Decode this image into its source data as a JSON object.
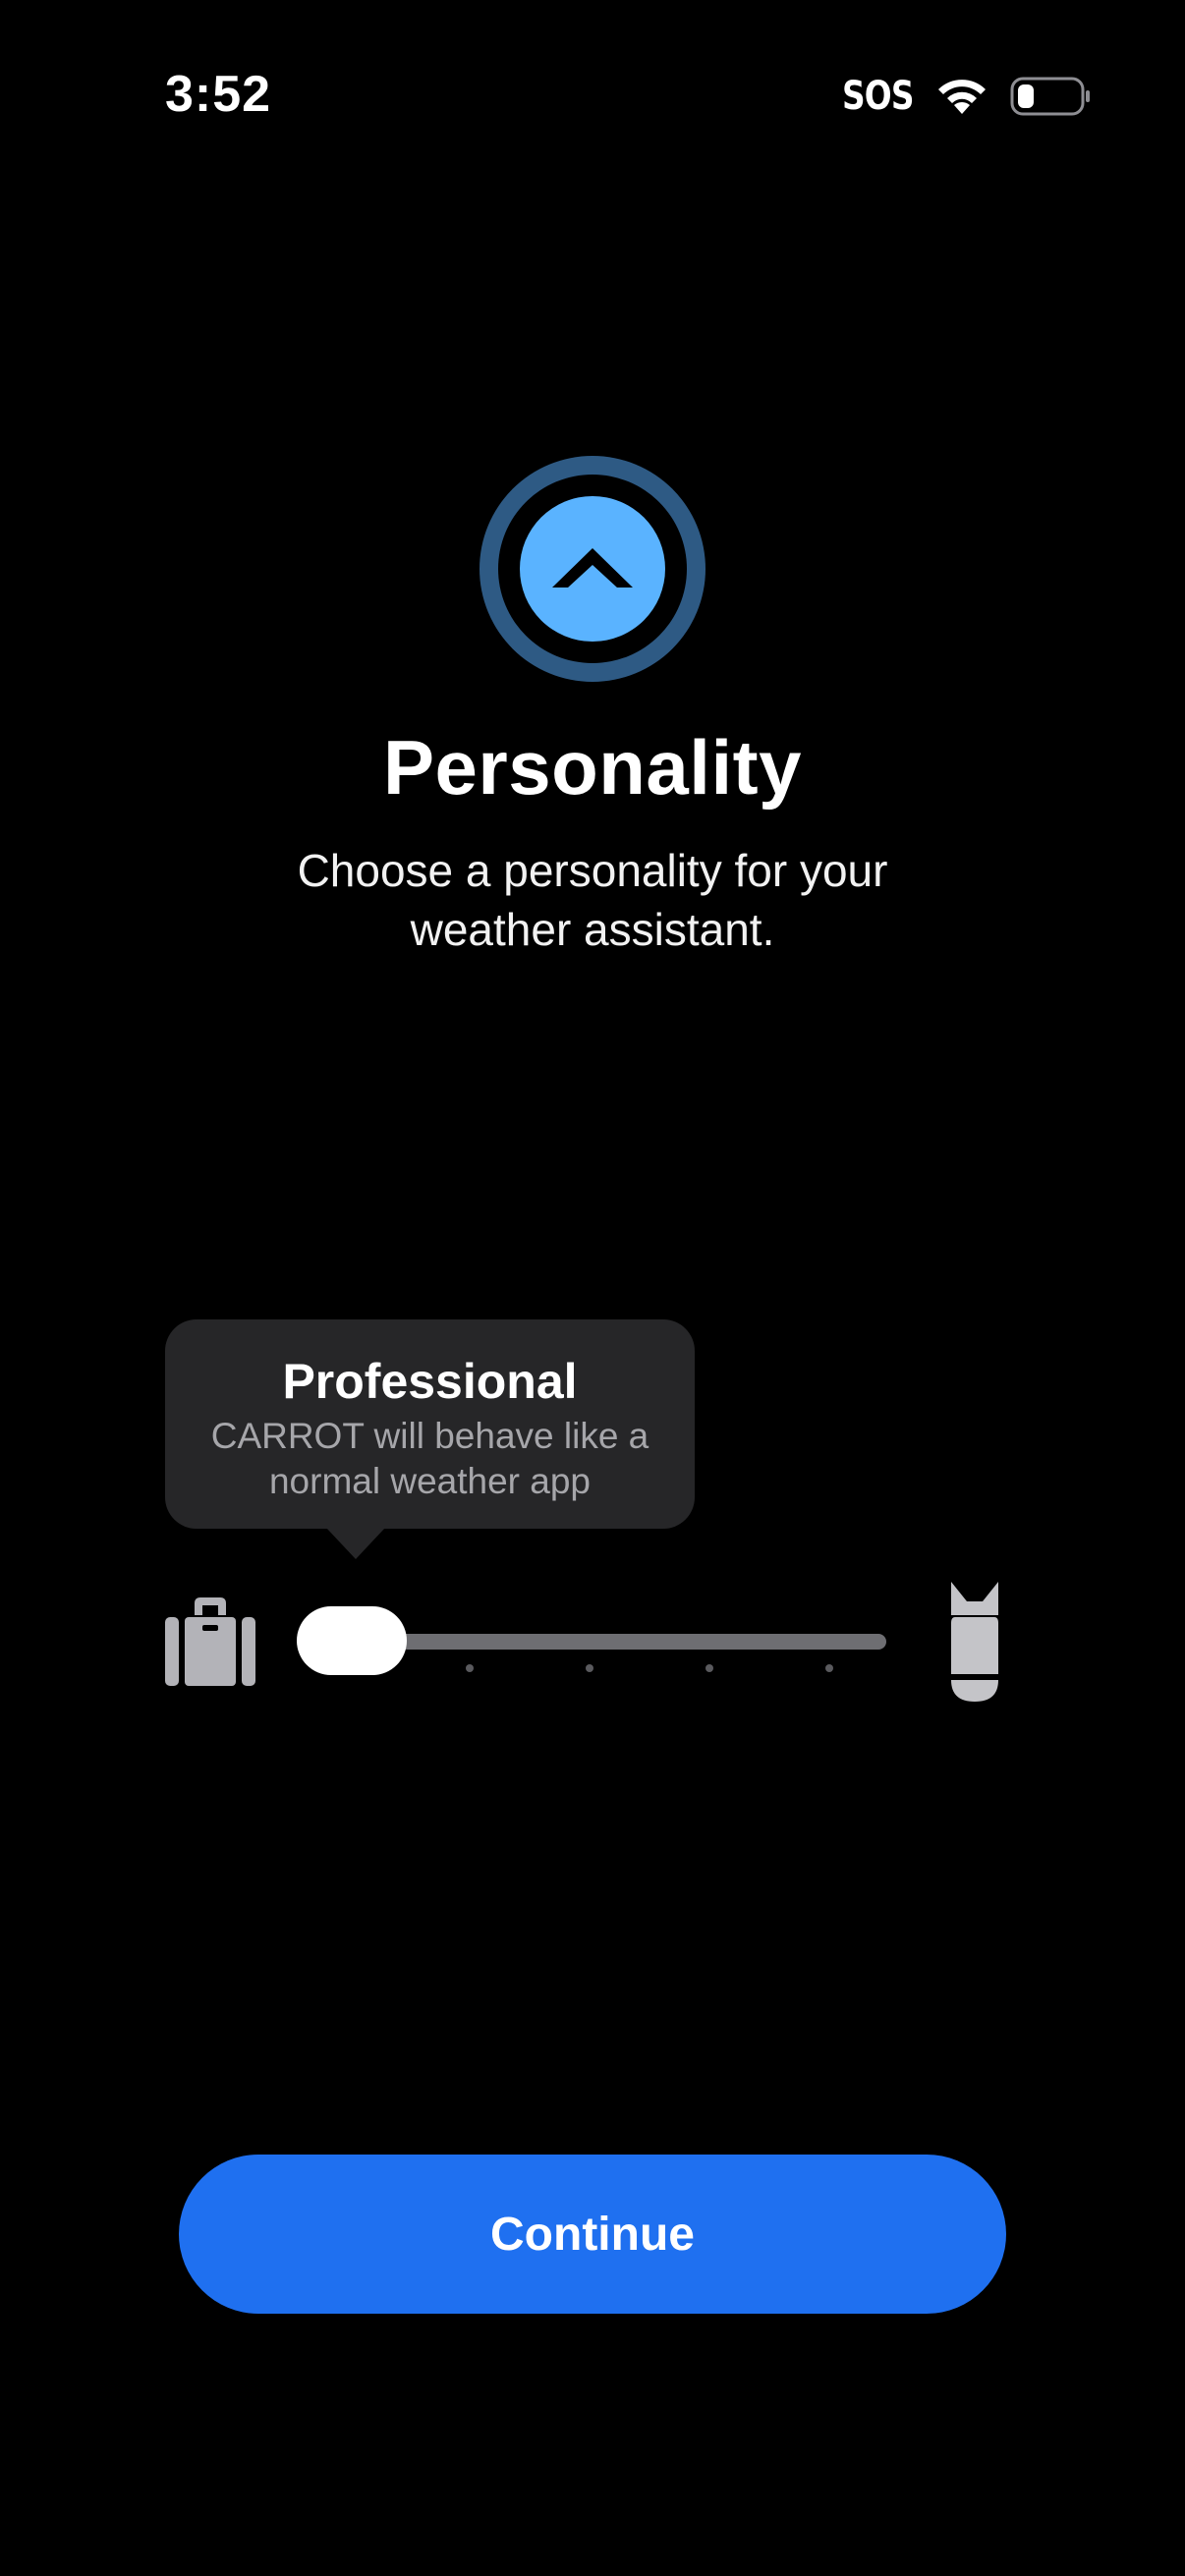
{
  "status_bar": {
    "time": "3:52",
    "sos": "SOS",
    "wifi_icon": "wifi-icon",
    "battery_icon": "battery-icon",
    "battery_level": 0.2
  },
  "hero": {
    "icon": "chevron-up-circle-icon",
    "colors": {
      "outer_ring": "#2e5a84",
      "inner_disc": "#5ab3ff",
      "chevron": "#000000"
    }
  },
  "header": {
    "title": "Personality",
    "subtitle": "Choose a personality for your weather assistant."
  },
  "personality_tooltip": {
    "title": "Professional",
    "description": "CARROT will behave like a normal weather app"
  },
  "personality_slider": {
    "min_icon": "briefcase-icon",
    "max_icon": "bomb-icon",
    "steps": 6,
    "selected_step": 0
  },
  "footer": {
    "continue_label": "Continue",
    "accent_color": "#1f70f0"
  }
}
